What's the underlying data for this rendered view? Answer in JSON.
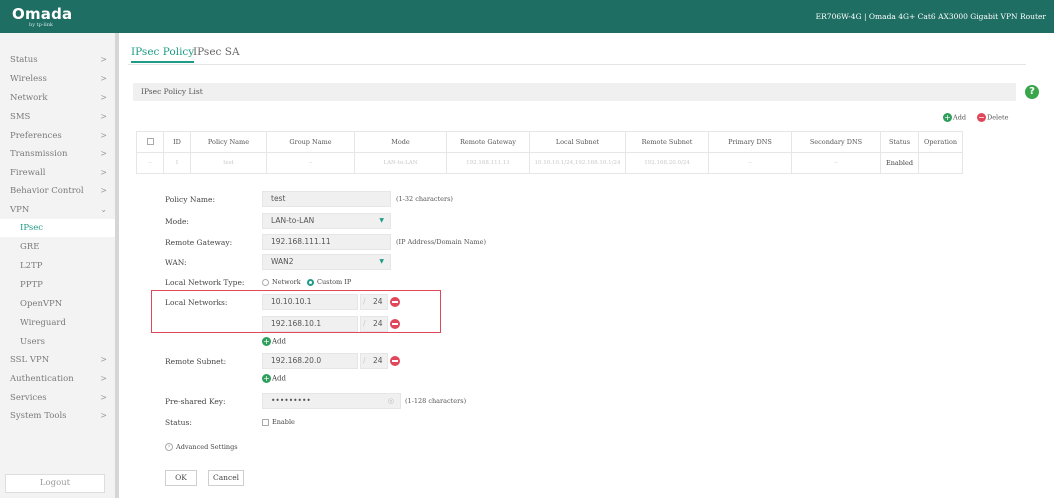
{
  "header": {
    "logo": "Omada",
    "logo_sub": "by tp-link",
    "device": "ER706W-4G | Omada 4G+ Cat6 AX3000 Gigabit VPN Router",
    "colors": {
      "topbar": "#1f6e63",
      "accent": "#1f9c86",
      "danger": "#e0475b",
      "add": "#2e9e5b"
    }
  },
  "sidebar": {
    "items": [
      {
        "label": "Status",
        "arrow": ">"
      },
      {
        "label": "Wireless",
        "arrow": ">"
      },
      {
        "label": "Network",
        "arrow": ">"
      },
      {
        "label": "SMS",
        "arrow": ">"
      },
      {
        "label": "Preferences",
        "arrow": ">"
      },
      {
        "label": "Transmission",
        "arrow": ">"
      },
      {
        "label": "Firewall",
        "arrow": ">"
      },
      {
        "label": "Behavior Control",
        "arrow": ">"
      },
      {
        "label": "VPN",
        "arrow": "⌄"
      },
      {
        "label": "IPsec"
      },
      {
        "label": "GRE"
      },
      {
        "label": "L2TP"
      },
      {
        "label": "PPTP"
      },
      {
        "label": "OpenVPN"
      },
      {
        "label": "Wireguard"
      },
      {
        "label": "Users"
      },
      {
        "label": "SSL VPN",
        "arrow": ">"
      },
      {
        "label": "Authentication",
        "arrow": ">"
      },
      {
        "label": "Services",
        "arrow": ">"
      },
      {
        "label": "System Tools",
        "arrow": ">"
      }
    ],
    "logout": "Logout"
  },
  "tabs": [
    "IPsec Policy",
    "IPsec SA"
  ],
  "list_title": "IPsec Policy List",
  "actions": {
    "add": "Add",
    "delete": "Delete"
  },
  "table": {
    "headers": [
      "",
      "ID",
      "Policy Name",
      "Group Name",
      "Mode",
      "Remote Gateway",
      "Local Subnet",
      "Remote Subnet",
      "Primary DNS",
      "Secondary DNS",
      "Status",
      "Operation"
    ],
    "row": [
      "--",
      "1",
      "test",
      "--",
      "LAN-to-LAN",
      "192.168.111.11",
      "10.10.10.1/24,192.168.10.1/24",
      "192.168.20.0/24",
      "--",
      "--",
      "Enabled",
      ""
    ]
  },
  "form": {
    "policy_name": {
      "label": "Policy Name:",
      "value": "test",
      "hint": "(1-32 characters)"
    },
    "mode": {
      "label": "Mode:",
      "value": "LAN-to-LAN"
    },
    "remote_gateway": {
      "label": "Remote Gateway:",
      "value": "192.168.111.11",
      "hint": "(IP Address/Domain Name)"
    },
    "wan": {
      "label": "WAN:",
      "value": "WAN2"
    },
    "local_network_type": {
      "label": "Local Network Type:",
      "options": [
        "Network",
        "Custom IP"
      ],
      "selected": "Custom IP"
    },
    "local_networks": {
      "label": "Local Networks:",
      "entries": [
        {
          "ip": "10.10.10.1",
          "mask": "24"
        },
        {
          "ip": "192.168.10.1",
          "mask": "24"
        }
      ],
      "add": "Add"
    },
    "remote_subnet": {
      "label": "Remote Subnet:",
      "ip": "192.168.20.0",
      "mask": "24",
      "add": "Add"
    },
    "psk": {
      "label": "Pre-shared Key:",
      "value": "•••••••••",
      "hint": "(1-128 characters)"
    },
    "status": {
      "label": "Status:",
      "checkbox": "Enable"
    },
    "advanced": "Advanced Settings",
    "ok": "OK",
    "cancel": "Cancel"
  }
}
